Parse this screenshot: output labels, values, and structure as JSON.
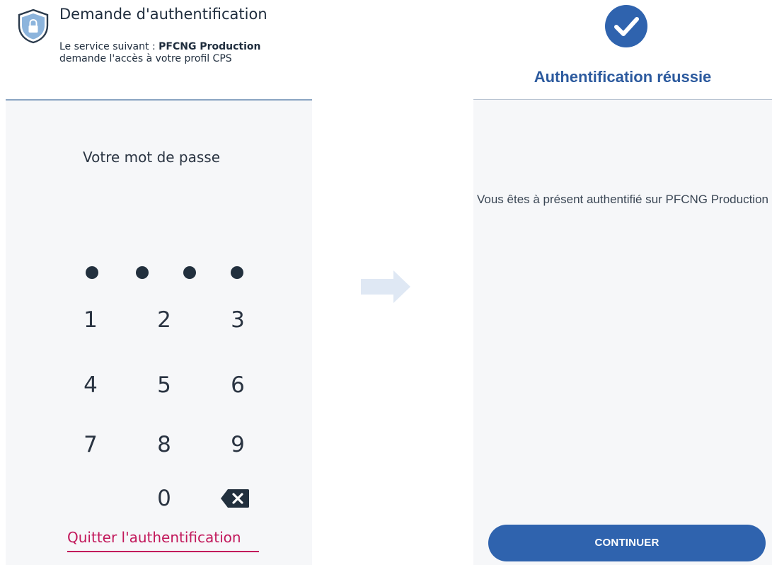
{
  "left": {
    "title": "Demande d'authentification",
    "service_prefix": "Le service suivant : ",
    "service_name": "PFCNG Production",
    "access_text": "demande l'accès à votre profil CPS",
    "password_label": "Votre mot de passe",
    "pin_filled_count": 4,
    "keys": [
      "1",
      "2",
      "3",
      "4",
      "5",
      "6",
      "7",
      "8",
      "9",
      "0"
    ],
    "quit_label": "Quitter l'authentification",
    "icons": {
      "shield": "shield-lock-icon",
      "backspace": "backspace-icon"
    }
  },
  "right": {
    "title": "Authentification réussie",
    "message": "Vous êtes à présent authentifié sur PFCNG Production",
    "continue_label": "CONTINUER",
    "icons": {
      "check": "check-circle-icon"
    }
  },
  "transition": {
    "icon": "arrow-right-icon"
  },
  "colors": {
    "accent_blue": "#2f63ae",
    "title_blue": "#2c5a9e",
    "quit_pink": "#c2185b",
    "shield_fill": "#8cb4dc",
    "body_bg": "#f6f7f9"
  }
}
